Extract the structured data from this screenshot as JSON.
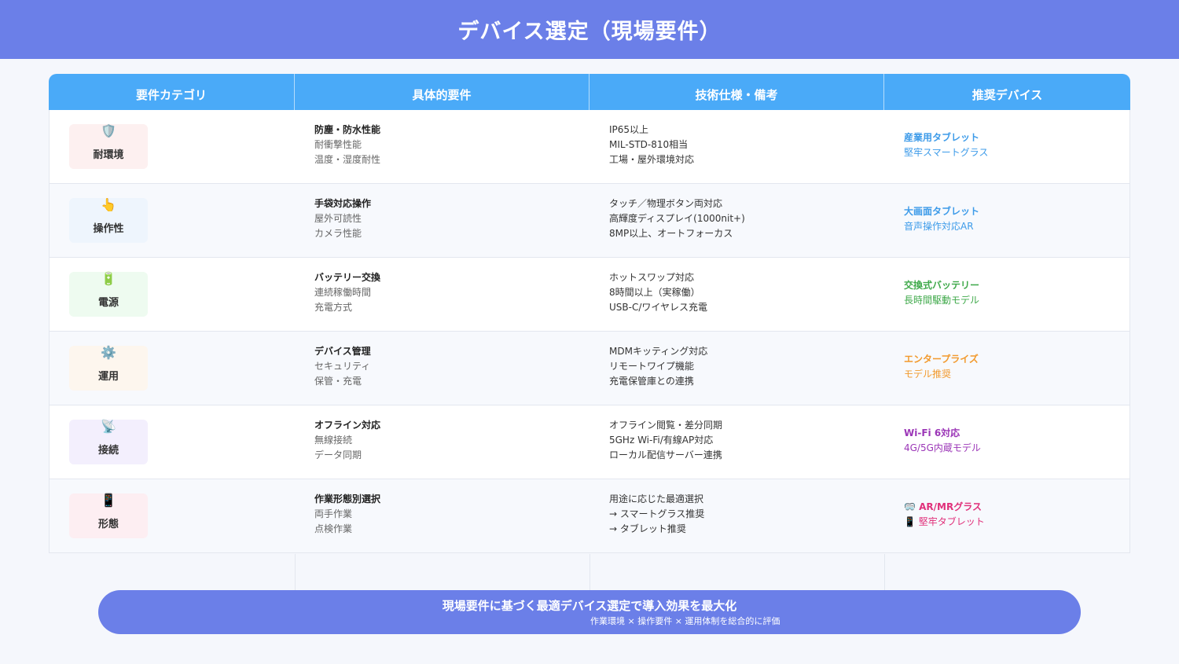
{
  "header": {
    "title": "デバイス選定（現場要件）"
  },
  "table": {
    "columns": [
      "要件カテゴリ",
      "具体的要件",
      "技術仕様・備考",
      "推奨デバイス"
    ],
    "rows": [
      {
        "category": {
          "icon": "shield-icon",
          "glyph": "🛡️",
          "label": "耐環境",
          "bg": "#fdf0f0"
        },
        "requirements": [
          "防塵・防水性能",
          "耐衝撃性能",
          "温度・湿度耐性"
        ],
        "specs": [
          "IP65以上",
          "MIL-STD-810相当",
          "工場・屋外環境対応"
        ],
        "recommend": [
          "産業用タブレット",
          "堅牢スマートグラス"
        ],
        "color": "#3d9be9"
      },
      {
        "category": {
          "icon": "pointing-hand-icon",
          "glyph": "👆",
          "label": "操作性",
          "bg": "#eef5fd"
        },
        "requirements": [
          "手袋対応操作",
          "屋外可読性",
          "カメラ性能"
        ],
        "specs": [
          "タッチ／物理ボタン両対応",
          "高輝度ディスプレイ(1000nit+)",
          "8MP以上、オートフォーカス"
        ],
        "recommend": [
          "大画面タブレット",
          "音声操作対応AR"
        ],
        "color": "#3d9be9"
      },
      {
        "category": {
          "icon": "battery-icon",
          "glyph": "🔋",
          "label": "電源",
          "bg": "#eefbf0"
        },
        "requirements": [
          "バッテリー交換",
          "連続稼働時間",
          "充電方式"
        ],
        "specs": [
          "ホットスワップ対応",
          "8時間以上（実稼働）",
          "USB-C/ワイヤレス充電"
        ],
        "recommend": [
          "交換式バッテリー",
          "長時間駆動モデル"
        ],
        "color": "#3fa94a"
      },
      {
        "category": {
          "icon": "gear-icon",
          "glyph": "⚙️",
          "label": "運用",
          "bg": "#fdf6ee"
        },
        "requirements": [
          "デバイス管理",
          "セキュリティ",
          "保管・充電"
        ],
        "specs": [
          "MDMキッティング対応",
          "リモートワイプ機能",
          "充電保管庫との連携"
        ],
        "recommend": [
          "エンタープライズ",
          "モデル推奨"
        ],
        "color": "#f29a2e"
      },
      {
        "category": {
          "icon": "satellite-icon",
          "glyph": "📡",
          "label": "接続",
          "bg": "#f3effd"
        },
        "requirements": [
          "オフライン対応",
          "無線接続",
          "データ同期"
        ],
        "specs": [
          "オフライン閲覧・差分同期",
          "5GHz Wi-Fi/有線AP対応",
          "ローカル配信サーバー連携"
        ],
        "recommend": [
          "Wi-Fi 6対応",
          "4G/5G内蔵モデル"
        ],
        "color": "#9b36b7"
      },
      {
        "category": {
          "icon": "mobile-phone-icon",
          "glyph": "📱",
          "label": "形態",
          "bg": "#fdeef2"
        },
        "requirements": [
          "作業形態別選択",
          "両手作業",
          "点検作業"
        ],
        "specs": [
          "用途に応じた最適選択",
          "→ スマートグラス推奨",
          "→ タブレット推奨"
        ],
        "recommend": [
          "🥽 AR/MRグラス",
          "📱 堅牢タブレット"
        ],
        "color": "#e0307a"
      }
    ]
  },
  "footer": {
    "title": "現場要件に基づく最適デバイス選定で導入効果を最大化",
    "subtitle": "作業環境 × 操作要件 × 運用体制を総合的に評価"
  }
}
